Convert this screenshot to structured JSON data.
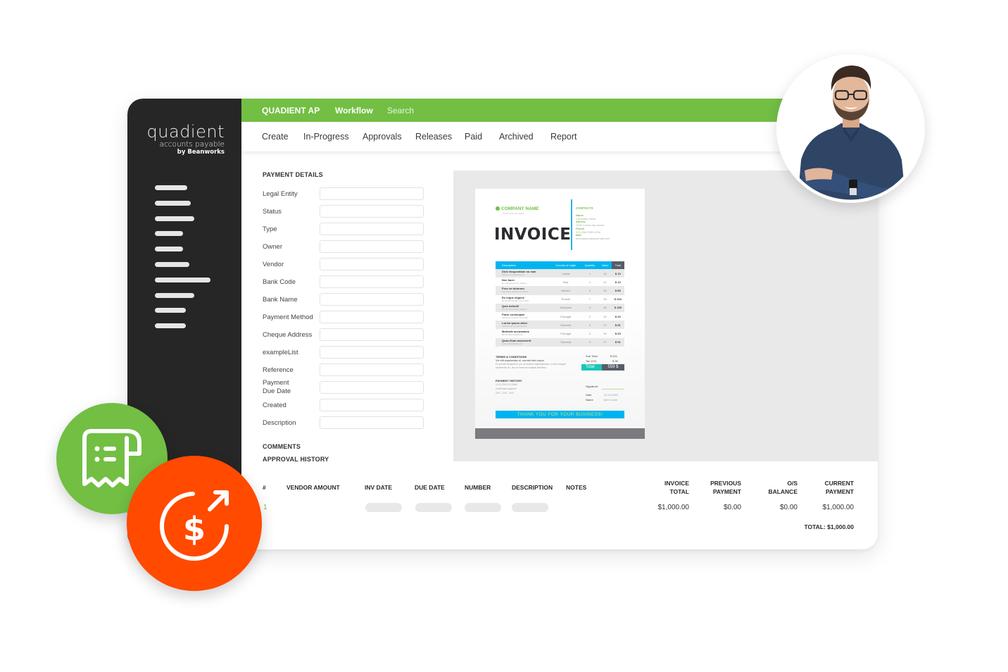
{
  "app": {
    "logo_line1": "quadient",
    "logo_line2": "accounts payable",
    "logo_line3": "by Beanworks",
    "brand_color": "#72bf44",
    "sidebar_color": "#262626",
    "accent_orange": "#ff4a00"
  },
  "topbar": {
    "brand": "QUADIENT AP",
    "workflow": "Workflow",
    "search": "Search"
  },
  "subnav": {
    "items": [
      "Create",
      "In-Progress",
      "Approvals",
      "Releases",
      "Paid",
      "Archived",
      "Report"
    ]
  },
  "sidebar": {
    "menu_icon_count": 10
  },
  "payment_details": {
    "title": "PAYMENT DETAILS",
    "fields": [
      {
        "label": "Legal Entity",
        "value": ""
      },
      {
        "label": "Status",
        "value": ""
      },
      {
        "label": "Type",
        "value": ""
      },
      {
        "label": "Owner",
        "value": ""
      },
      {
        "label": "Vendor",
        "value": ""
      },
      {
        "label": "Bank Code",
        "value": ""
      },
      {
        "label": "Bank Name",
        "value": ""
      },
      {
        "label": "Payment Method",
        "value": ""
      },
      {
        "label": "Cheque Address",
        "value": ""
      },
      {
        "label": "exampleList",
        "value": ""
      },
      {
        "label": "Reference",
        "value": ""
      },
      {
        "label": "Payment\nDue Date",
        "value": ""
      },
      {
        "label": "Created",
        "value": ""
      },
      {
        "label": "Description",
        "value": ""
      }
    ],
    "comments": "COMMENTS",
    "approval_history": "APPROVAL HISTORY"
  },
  "invoice_preview": {
    "company_name": "COMPANY NAME",
    "company_tagline": "YOUR SLOGAN HERE",
    "title": "INVOICE",
    "contacts_title": "CONTACTS",
    "contacts": [
      {
        "key": "Name",
        "value": "Company name"
      },
      {
        "key": "Adress",
        "value": "1234 Lorem city house"
      },
      {
        "key": "Phone",
        "value": "123-456-7890-1234"
      },
      {
        "key": "Mail",
        "value": "loremipsum@yourmail.com"
      }
    ],
    "table_headers": [
      "Description",
      "Country of origin",
      "Quantity",
      "Value",
      "Total"
    ],
    "table_rows": [
      {
        "desc": "Dicit eloquentiam no eam",
        "sub": "Meliore ius definitionem",
        "country": "Latvia",
        "qty": "1",
        "value": "10",
        "total": "$ 10"
      },
      {
        "desc": "Nec facer",
        "sub": "Eu sed assueverit, adipisci",
        "country": "Italy",
        "qty": "1",
        "value": "12",
        "total": "$ 12"
      },
      {
        "desc": "Fero rei dolorum",
        "sub": "Quo libris sapientem meliore",
        "country": "Mexico",
        "qty": "4",
        "value": "20",
        "total": "$ 80"
      },
      {
        "desc": "Ex reque eligens",
        "sub": "Et suscipit audiam commodo",
        "country": "Russia",
        "qty": "7",
        "value": "34",
        "total": "$ 244"
      },
      {
        "desc": "Quis deleniti",
        "sub": "Eu sed assueverit, adipisci",
        "country": "Denmark",
        "qty": "3",
        "value": "45",
        "total": "$ 135"
      },
      {
        "desc": "Facer consequat",
        "sub": "Mentitum nostrum sit ornate",
        "country": "Portugal",
        "qty": "2",
        "value": "10",
        "total": "$ 20"
      },
      {
        "desc": "Lorem ipsum dolor",
        "sub": "Laboramus temporibus ad",
        "country": "Slovenia",
        "qty": "3",
        "value": "17",
        "total": "$ 51"
      },
      {
        "desc": "Molestie accusamus",
        "sub": "Eu sit vidit mandamus",
        "country": "Portugal",
        "qty": "2",
        "value": "10",
        "total": "$ 20"
      },
      {
        "desc": "Quas illum assueverit",
        "sub": "Lorem disputando pro",
        "country": "Slovenia",
        "qty": "3",
        "value": "17",
        "total": "$ 51"
      }
    ],
    "terms_title": "TERMS & CONDITIONS",
    "terms_line": "Vix elit expetenda ei, nonnet diet corpo",
    "terms_body": "Et qui falli temporibus, per an lucilius vituperatoribus, in eruet feugait expetendis vix, duo ex harmoni volutpat sensibus.",
    "sub_total_label": "Sub Total",
    "sub_total": "$ 521",
    "tax_label": "Tax 10%",
    "tax": "$ 38",
    "total_label": "Total",
    "total": "559 $",
    "payment_history_title": "PAYMENT HISTORY",
    "payment_history_lines": [
      "12.12.2019 10:10AM",
      "Credit card payment",
      "XXX - XXX - XXX"
    ],
    "signature_label": "Signature:",
    "date_label": "Date",
    "date_value": "12.12.2019",
    "name_label": "Name",
    "name_value": "John Lorke",
    "thanks": "THANK YOU FOR YOUR BUSINESS!"
  },
  "payments_table": {
    "headers": {
      "num": "#",
      "vendor_amount": "VENDOR AMOUNT",
      "inv_date": "INV DATE",
      "due_date": "DUE DATE",
      "number": "NUMBER",
      "description": "DESCRIPTION",
      "notes": "NOTES",
      "invoice_total": "INVOICE\nTOTAL",
      "previous_payment": "PREVIOUS\nPAYMENT",
      "os_balance": "O/S\nBALANCE",
      "current_payment": "CURRENT\nPAYMENT"
    },
    "rows": [
      {
        "num": "1",
        "invoice_total": "$1,000.00",
        "previous_payment": "$0.00",
        "os_balance": "$0.00",
        "current_payment": "$1,000.00"
      }
    ],
    "total": "TOTAL: $1,000.00"
  },
  "badges": {
    "green_icon": "receipt-roll-icon",
    "orange_icon": "dollar-refresh-arrow-icon"
  },
  "avatar": {
    "description": "smiling man with glasses, arms crossed"
  }
}
